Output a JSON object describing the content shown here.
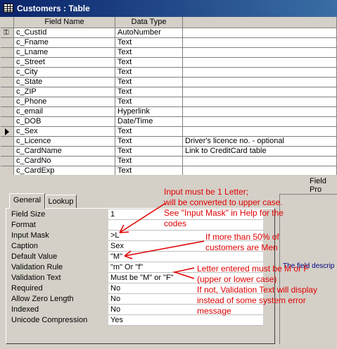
{
  "window": {
    "title": "Customers : Table"
  },
  "grid": {
    "headers": {
      "name": "Field Name",
      "type": "Data Type",
      "desc": ""
    },
    "rows": [
      {
        "name": "c_CustId",
        "type": "AutoNumber",
        "desc": "",
        "marker": "key"
      },
      {
        "name": "c_Fname",
        "type": "Text",
        "desc": ""
      },
      {
        "name": "c_Lname",
        "type": "Text",
        "desc": ""
      },
      {
        "name": "c_Street",
        "type": "Text",
        "desc": ""
      },
      {
        "name": "c_City",
        "type": "Text",
        "desc": ""
      },
      {
        "name": "c_State",
        "type": "Text",
        "desc": ""
      },
      {
        "name": "c_ZIP",
        "type": "Text",
        "desc": ""
      },
      {
        "name": "c_Phone",
        "type": "Text",
        "desc": ""
      },
      {
        "name": "c_email",
        "type": "Hyperlink",
        "desc": ""
      },
      {
        "name": "c_DOB",
        "type": "Date/Time",
        "desc": ""
      },
      {
        "name": "c_Sex",
        "type": "Text",
        "desc": "",
        "marker": "current"
      },
      {
        "name": "c_Licence",
        "type": "Text",
        "desc": "Driver's licence no. - optional"
      },
      {
        "name": "c_CardName",
        "type": "Text",
        "desc": "Link to CreditCard table"
      },
      {
        "name": "c_CardNo",
        "type": "Text",
        "desc": ""
      },
      {
        "name": "c_CardExp",
        "type": "Text",
        "desc": ""
      }
    ]
  },
  "field_properties_label": "Field Pro",
  "tabs": {
    "general": "General",
    "lookup": "Lookup"
  },
  "properties": [
    {
      "label": "Field Size",
      "value": "1"
    },
    {
      "label": "Format",
      "value": ""
    },
    {
      "label": "Input Mask",
      "value": ">L"
    },
    {
      "label": "Caption",
      "value": "Sex"
    },
    {
      "label": "Default Value",
      "value": "\"M\""
    },
    {
      "label": "Validation Rule",
      "value": "\"m\" Or \"f\""
    },
    {
      "label": "Validation Text",
      "value": "Must be \"M\" or \"F\""
    },
    {
      "label": "Required",
      "value": "No"
    },
    {
      "label": "Allow Zero Length",
      "value": "No"
    },
    {
      "label": "Indexed",
      "value": "No"
    },
    {
      "label": "Unicode Compression",
      "value": "Yes"
    }
  ],
  "description_text": "The field descrip",
  "annotations": {
    "input_mask": [
      "Input must be 1 Letter;",
      "will be converted to upper case.",
      "See \"Input Mask\" in Help for the",
      "codes"
    ],
    "default_value": [
      "If more than 50% of",
      "customers are Men"
    ],
    "validation": [
      "Letter entered must be M or F",
      "(upper or lower case)",
      "If not, Validation Text will display",
      "instead of some system error",
      "message"
    ]
  },
  "colors": {
    "annotation": "#e00000",
    "titlebar": "#0a246a"
  }
}
